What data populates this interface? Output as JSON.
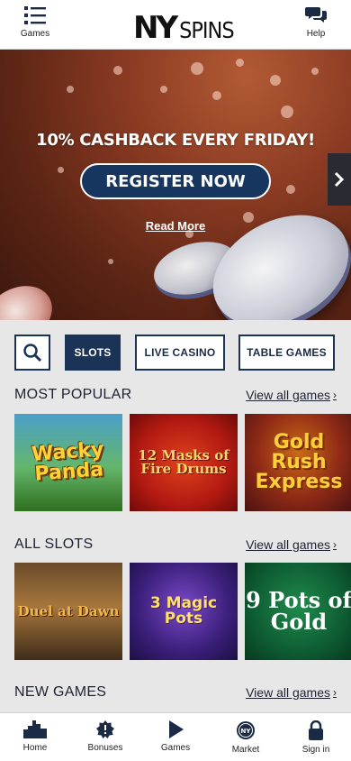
{
  "header": {
    "games_label": "Games",
    "help_label": "Help",
    "logo_ny": "NY",
    "logo_spins": "SPINS"
  },
  "banner": {
    "title": "10% CASHBACK EVERY FRIDAY!",
    "cta_label": "REGISTER NOW",
    "read_more": "Read More"
  },
  "filters": {
    "tabs": [
      {
        "label": "SLOTS",
        "active": true
      },
      {
        "label": "LIVE CASINO",
        "active": false
      },
      {
        "label": "TABLE GAMES",
        "active": false
      }
    ]
  },
  "sections": {
    "most_popular": {
      "title": "MOST POPULAR",
      "view_all": "View all games",
      "games": [
        "Wacky Panda",
        "12 Masks of Fire Drums",
        "Gold Rush Express"
      ]
    },
    "all_slots": {
      "title": "ALL SLOTS",
      "view_all": "View all games",
      "games": [
        "Duel at Dawn",
        "3 Magic Pots",
        "9 Pots of Gold"
      ]
    },
    "new_games": {
      "title": "NEW GAMES",
      "view_all": "View all games"
    }
  },
  "bottom_nav": {
    "items": [
      {
        "label": "Home",
        "icon": "city-skyline-icon"
      },
      {
        "label": "Bonuses",
        "icon": "bonus-badge-icon"
      },
      {
        "label": "Games",
        "icon": "play-icon"
      },
      {
        "label": "Market",
        "icon": "ny-coin-icon"
      },
      {
        "label": "Sign in",
        "icon": "lock-icon"
      }
    ]
  },
  "colors": {
    "navy": "#1b3356",
    "page_bg": "#e7e7e7",
    "banner_bg": "#8a3a22"
  }
}
